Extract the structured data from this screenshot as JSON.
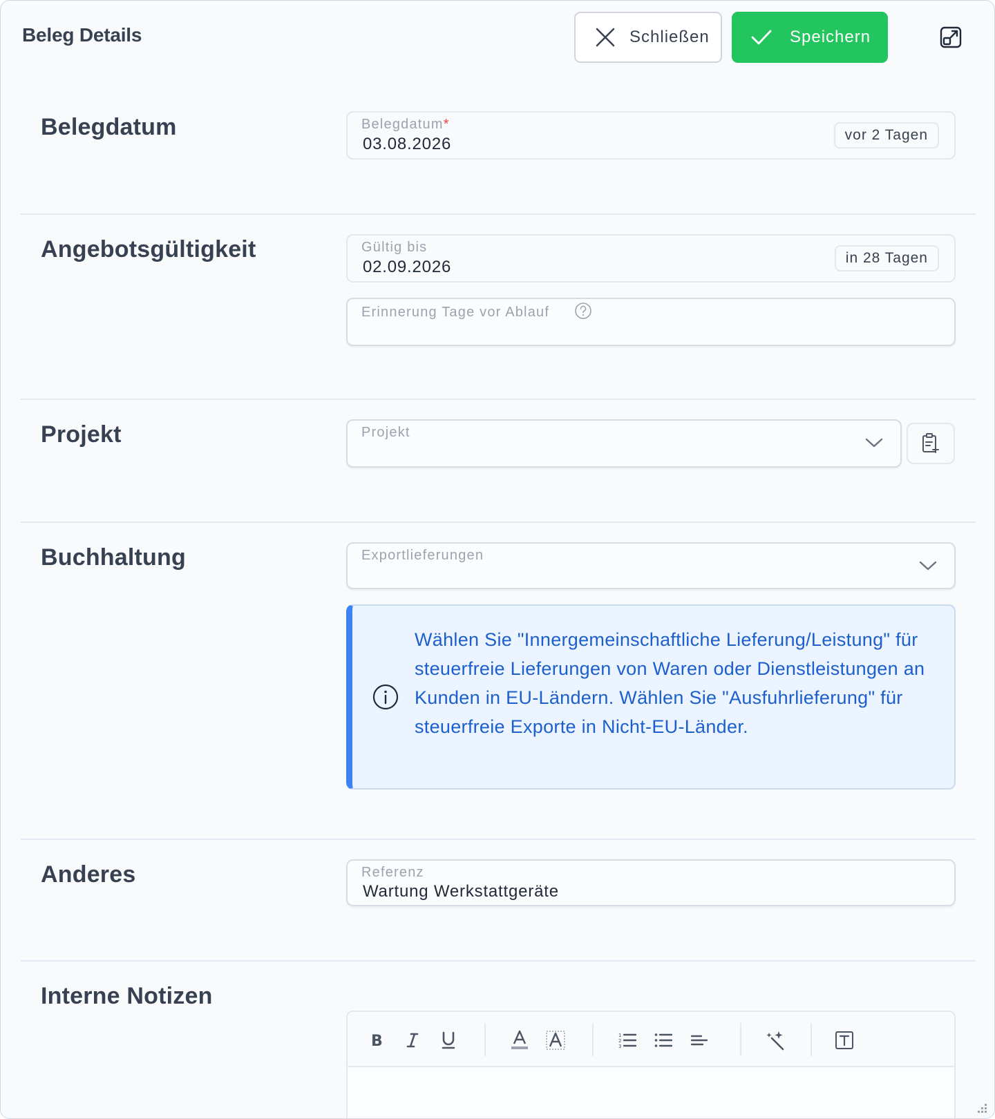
{
  "header": {
    "title": "Beleg Details",
    "close_label": "Schließen",
    "save_label": "Speichern"
  },
  "sections": {
    "belegdatum": {
      "label": "Belegdatum",
      "field_label": "Belegdatum",
      "value": "03.08.2026",
      "badge": "vor 2 Tagen"
    },
    "angebot": {
      "label": "Angebotsgültigkeit",
      "field_label": "Gültig bis",
      "value": "02.09.2026",
      "badge": "in 28 Tagen",
      "reminder_label": "Erinnerung Tage vor Ablauf"
    },
    "projekt": {
      "label": "Projekt",
      "field_label": "Projekt"
    },
    "buchhaltung": {
      "label": "Buchhaltung",
      "field_label": "Exportlieferungen",
      "info": "Wählen Sie \"Innergemeinschaftliche Lieferung/Leistung\" für steuerfreie Lieferungen von Waren oder Dienstleistungen an Kunden in EU-Ländern. Wählen Sie \"Ausfuhrlieferung\" für steuerfreie Exporte in Nicht-EU-Länder."
    },
    "anderes": {
      "label": "Anderes",
      "field_label": "Referenz",
      "value": "Wartung Werkstattgeräte"
    },
    "notizen": {
      "label": "Interne Notizen"
    }
  },
  "colors": {
    "save": "#22c55e",
    "info_accent": "#3b82f6",
    "info_text": "#1d5fcc",
    "required": "#ef4444"
  },
  "icons": {
    "close": "close-icon",
    "save": "check-icon",
    "expand": "expand-icon",
    "help": "help-icon",
    "chevron": "chevron-down-icon",
    "clipboard": "clipboard-add-icon",
    "info": "info-icon"
  }
}
